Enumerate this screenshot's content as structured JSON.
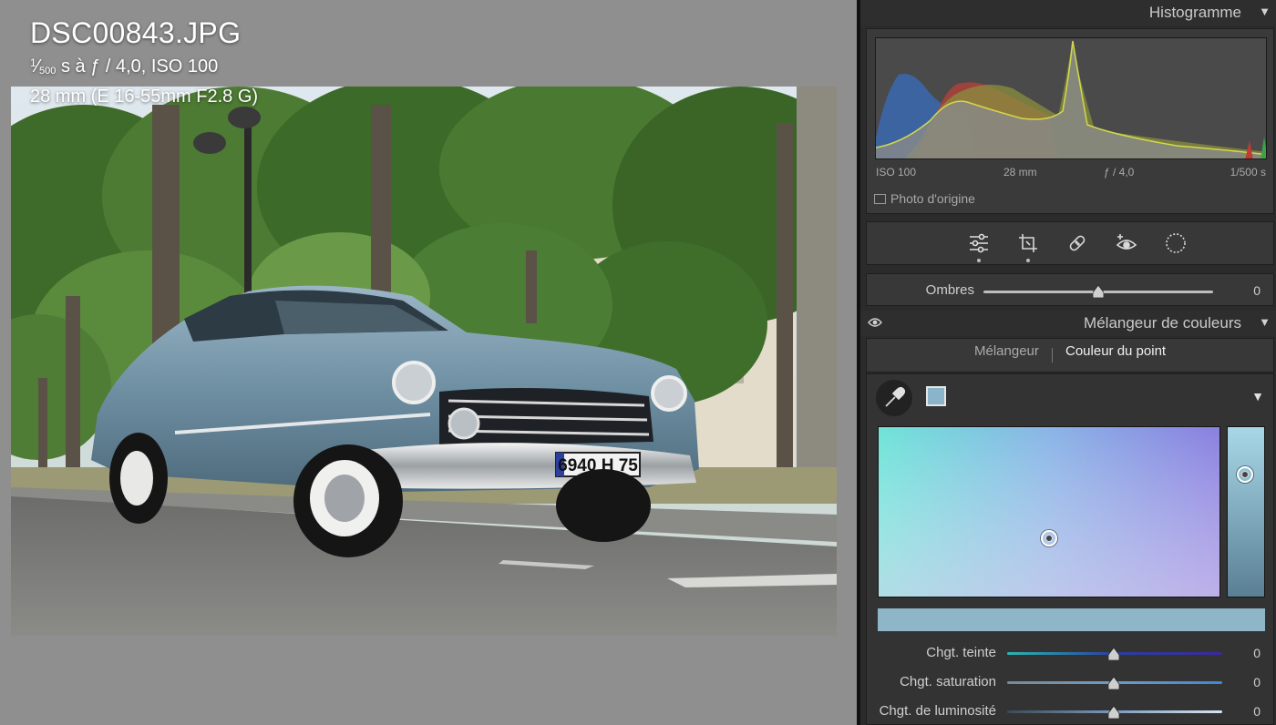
{
  "photo": {
    "filename": "DSC00843.JPG",
    "shutter_numerator": "1",
    "shutter_denominator": "500",
    "exposure_rest": " s à ƒ / 4,0, ISO 100",
    "lens_info": "28 mm (E 16-55mm F2.8 G)",
    "plate_text": "6940 H 75"
  },
  "histogram": {
    "title": "Histogramme",
    "iso": "ISO 100",
    "focal": "28 mm",
    "aperture": "ƒ / 4,0",
    "shutter": "1/500 s",
    "original_photo_label": "Photo d'origine"
  },
  "toolbar": {
    "tools": [
      "adjust-sliders-icon",
      "crop-icon",
      "healing-bandage-icon",
      "red-eye-icon",
      "masking-icon"
    ]
  },
  "basic": {
    "shadows_label": "Ombres",
    "shadows_value": "0"
  },
  "color_mixer": {
    "title": "Mélangeur de couleurs",
    "tabs": [
      {
        "label": "Mélangeur",
        "active": false
      },
      {
        "label": "Couleur du point",
        "active": true
      }
    ],
    "sample_color": "#8ab4c9",
    "sliders": [
      {
        "label": "Chgt. teinte",
        "value": "0"
      },
      {
        "label": "Chgt. saturation",
        "value": "0"
      },
      {
        "label": "Chgt. de luminosité",
        "value": "0"
      }
    ]
  }
}
